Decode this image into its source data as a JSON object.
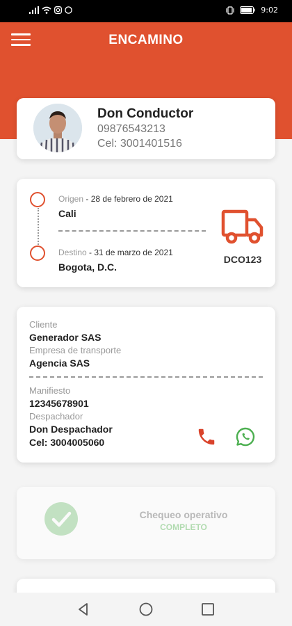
{
  "status_bar": {
    "time": "9:02"
  },
  "header": {
    "title": "ENCAMINO"
  },
  "driver": {
    "name": "Don Conductor",
    "id_number": "09876543213",
    "phone": "Cel: 3001401516"
  },
  "route": {
    "origin_label": "Origen",
    "origin_date": "28 de febrero de 2021",
    "origin_city": "Cali",
    "destination_label": "Destino",
    "destination_date": "31 de marzo de 2021",
    "destination_city": "Bogota, D.C.",
    "plate": "DCO123"
  },
  "info": {
    "client_label": "Cliente",
    "client_value": "Generador SAS",
    "transport_label": "Empresa de transporte",
    "transport_value": "Agencia SAS",
    "manifest_label": "Manifiesto",
    "manifest_value": "12345678901",
    "dispatcher_label": "Despachador",
    "dispatcher_name": "Don Despachador",
    "dispatcher_phone": "Cel: 3004005060"
  },
  "check": {
    "title": "Chequeo operativo",
    "status": "COMPLETO"
  },
  "colors": {
    "brand": "#e0512f",
    "success": "#7cc87a",
    "whatsapp": "#4caf50"
  },
  "icons": [
    "menu-icon",
    "truck-icon",
    "phone-icon",
    "whatsapp-icon",
    "check-icon",
    "back-icon",
    "home-icon",
    "recents-icon"
  ]
}
